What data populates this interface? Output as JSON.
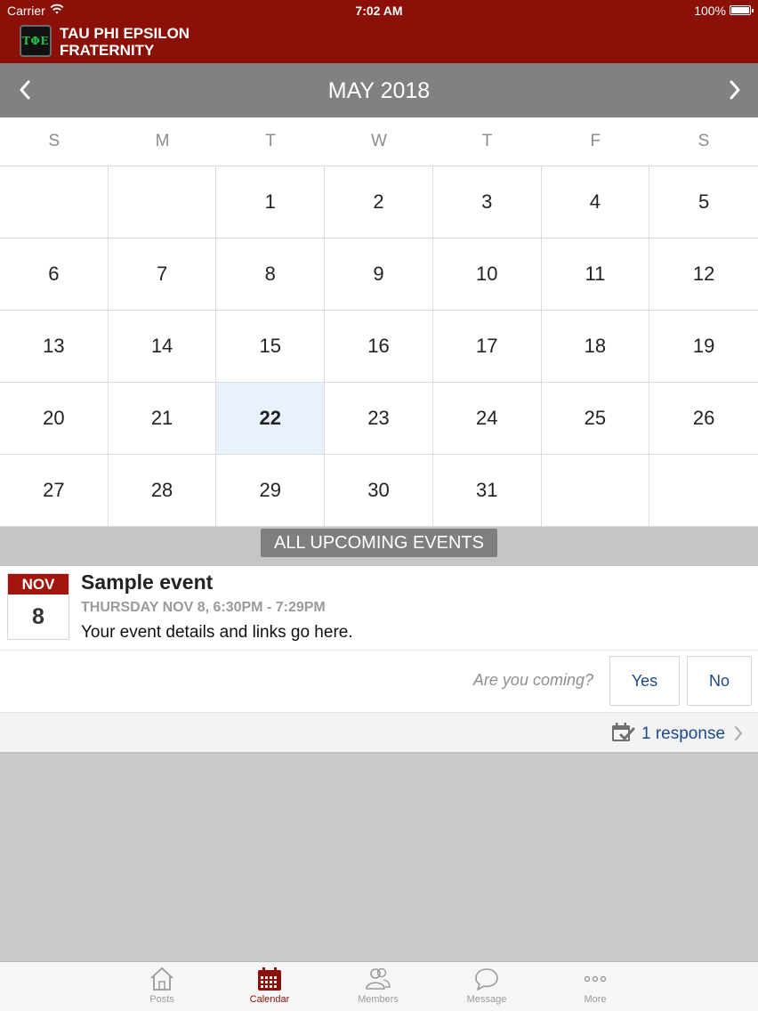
{
  "status_bar": {
    "carrier": "Carrier",
    "time": "7:02 AM",
    "battery": "100%"
  },
  "header": {
    "logo_text": "ΤΦΕ",
    "org_line1": "TAU PHI EPSILON",
    "org_line2": "FRATERNITY",
    "brand_color": "#8b1007"
  },
  "calendar": {
    "month_label": "MAY 2018",
    "weekdays": [
      "S",
      "M",
      "T",
      "W",
      "T",
      "F",
      "S"
    ],
    "today": "22",
    "weeks": [
      [
        "",
        "",
        "1",
        "2",
        "3",
        "4",
        "5"
      ],
      [
        "6",
        "7",
        "8",
        "9",
        "10",
        "11",
        "12"
      ],
      [
        "13",
        "14",
        "15",
        "16",
        "17",
        "18",
        "19"
      ],
      [
        "20",
        "21",
        "22",
        "23",
        "24",
        "25",
        "26"
      ],
      [
        "27",
        "28",
        "29",
        "30",
        "31",
        "",
        ""
      ]
    ]
  },
  "upcoming": {
    "label": "ALL UPCOMING EVENTS"
  },
  "event": {
    "month": "NOV",
    "day": "8",
    "title": "Sample event",
    "time": "THURSDAY NOV 8, 6:30PM - 7:29PM",
    "description": "Your event details and links go here.",
    "rsvp_question": "Are you coming?",
    "yes_label": "Yes",
    "no_label": "No",
    "responses_label": "1 response"
  },
  "tabs": [
    {
      "id": "posts",
      "label": "Posts",
      "icon": "home-icon"
    },
    {
      "id": "calendar",
      "label": "Calendar",
      "icon": "calendar-icon",
      "active": true
    },
    {
      "id": "members",
      "label": "Members",
      "icon": "people-icon"
    },
    {
      "id": "message",
      "label": "Message",
      "icon": "speech-bubble-icon"
    },
    {
      "id": "more",
      "label": "More",
      "icon": "more-dots-icon"
    }
  ]
}
